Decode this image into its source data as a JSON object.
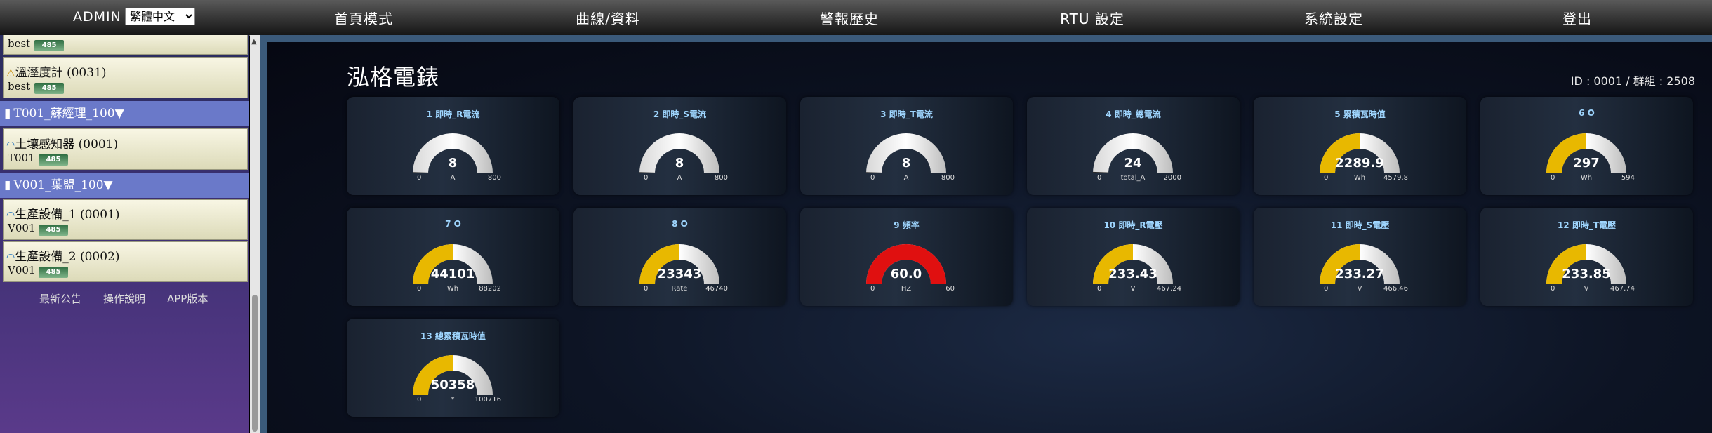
{
  "header": {
    "user": "ADMIN",
    "language": "繁體中文",
    "nav": [
      "首頁模式",
      "曲線/資料",
      "警報歷史",
      "RTU  設定",
      "系統設定",
      "登出"
    ]
  },
  "sidebar": {
    "top_partial": {
      "sub": "best",
      "badge": "485"
    },
    "items": [
      {
        "name": "溫溼度計 (0031)",
        "sub": "best",
        "badge": "485"
      },
      {
        "group": "T001_蘇經理_100"
      },
      {
        "name": "土壤感知器 (0001)",
        "sub": "T001",
        "badge": "485"
      },
      {
        "group": "V001_葉盟_100"
      },
      {
        "name": "生產設備_1 (0001)",
        "sub": "V001",
        "badge": "485"
      },
      {
        "name": "生產設備_2 (0002)",
        "sub": "V001",
        "badge": "485"
      }
    ],
    "links": [
      "最新公告",
      "操作說明",
      "APP版本"
    ]
  },
  "page": {
    "title": "泓格電錶",
    "id_label": "ID : 0001  /  群組 : 2508"
  },
  "gauges": [
    {
      "title": "1 即時_R電流",
      "value": "8",
      "min": "0",
      "unit": "A",
      "max": "800",
      "fraction": 0.01,
      "color": "#2a2a2a"
    },
    {
      "title": "2 即時_S電流",
      "value": "8",
      "min": "0",
      "unit": "A",
      "max": "800",
      "fraction": 0.01,
      "color": "#2a2a2a"
    },
    {
      "title": "3 即時_T電流",
      "value": "8",
      "min": "0",
      "unit": "A",
      "max": "800",
      "fraction": 0.01,
      "color": "#2a2a2a"
    },
    {
      "title": "4 即時_總電流",
      "value": "24",
      "min": "0",
      "unit": "total_A",
      "max": "2000",
      "fraction": 0.012,
      "color": "#2a2a2a"
    },
    {
      "title": "5 累積瓦時值",
      "value": "2289.9",
      "min": "0",
      "unit": "Wh",
      "max": "4579.8",
      "fraction": 0.5,
      "color": "#e8b800"
    },
    {
      "title": "6 O",
      "value": "297",
      "min": "0",
      "unit": "Wh",
      "max": "594",
      "fraction": 0.5,
      "color": "#e8b800"
    },
    {
      "title": "7 O",
      "value": "44101",
      "min": "0",
      "unit": "Wh",
      "max": "88202",
      "fraction": 0.5,
      "color": "#e8b800"
    },
    {
      "title": "8 O",
      "value": "23343",
      "min": "0",
      "unit": "Rate",
      "max": "46740",
      "fraction": 0.5,
      "color": "#e8b800"
    },
    {
      "title": "9 頻率",
      "value": "60.0",
      "min": "0",
      "unit": "HZ",
      "max": "60",
      "fraction": 1.0,
      "color": "#e01010"
    },
    {
      "title": "10 即時_R電壓",
      "value": "233.43",
      "min": "0",
      "unit": "V",
      "max": "467.24",
      "fraction": 0.5,
      "color": "#e8b800"
    },
    {
      "title": "11 即時_S電壓",
      "value": "233.27",
      "min": "0",
      "unit": "V",
      "max": "466.46",
      "fraction": 0.5,
      "color": "#e8b800"
    },
    {
      "title": "12 即時_T電壓",
      "value": "233.85",
      "min": "0",
      "unit": "V",
      "max": "467.74",
      "fraction": 0.5,
      "color": "#e8b800"
    },
    {
      "title": "13 總累積瓦時值",
      "value": "50358",
      "min": "0",
      "unit": "*",
      "max": "100716",
      "fraction": 0.5,
      "color": "#e8b800"
    }
  ]
}
